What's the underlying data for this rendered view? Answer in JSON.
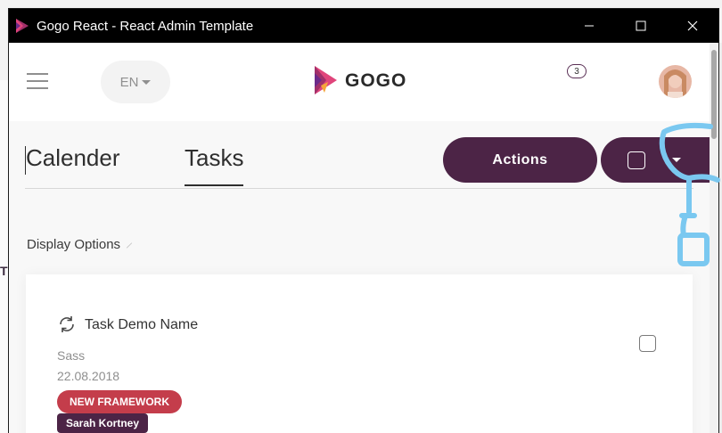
{
  "window": {
    "title": "Gogo React - React Admin Template",
    "controls": {
      "minimize": "minimize-icon",
      "maximize": "maximize-icon",
      "close": "close-icon"
    }
  },
  "topnav": {
    "menu_icon": "hamburger-icon",
    "language": "EN",
    "logo_text": "GOGO",
    "notification_count": "3",
    "avatar": "user-avatar"
  },
  "tabs": [
    {
      "label": "Calender",
      "active": false
    },
    {
      "label": "Tasks",
      "active": true
    }
  ],
  "toolbar": {
    "actions_label": "Actions"
  },
  "display_options_label": "Display Options",
  "task": {
    "name": "Task Demo Name",
    "category": "Sass",
    "date": "22.08.2018",
    "badge_status": "NEW FRAMEWORK",
    "badge_user": "Sarah Kortney"
  },
  "background": {
    "left_letter": "T"
  },
  "colors": {
    "primary": "#4c2446",
    "danger": "#c43d4b",
    "annotation": "#7ac8f0",
    "titlebar": "#000000"
  }
}
